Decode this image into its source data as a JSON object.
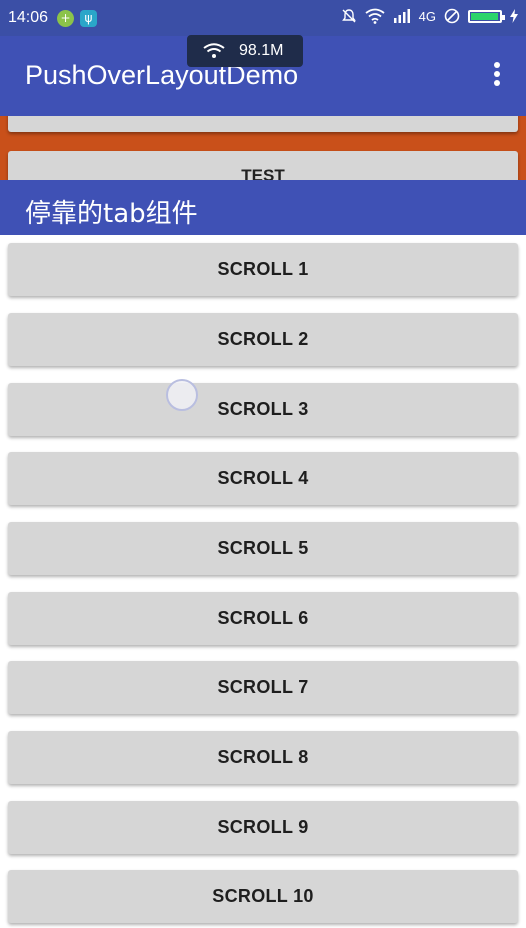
{
  "status_bar": {
    "time": "14:06",
    "network": "4G",
    "badges": [
      "plus-badge-icon",
      "usb-icon"
    ]
  },
  "network_overlay": {
    "speed": "98.1M"
  },
  "app_bar": {
    "title": "PushOverLayoutDemo"
  },
  "header_section": {
    "button_label": "TEST",
    "background": "#c9501a"
  },
  "tab_bar": {
    "label": "停靠的tab组件"
  },
  "list": {
    "items": [
      {
        "label": "SCROLL 1"
      },
      {
        "label": "SCROLL 2"
      },
      {
        "label": "SCROLL 3"
      },
      {
        "label": "SCROLL 4"
      },
      {
        "label": "SCROLL 5"
      },
      {
        "label": "SCROLL 6"
      },
      {
        "label": "SCROLL 7"
      },
      {
        "label": "SCROLL 8"
      },
      {
        "label": "SCROLL 9"
      },
      {
        "label": "SCROLL 10"
      }
    ]
  },
  "colors": {
    "primary": "#3f51b5",
    "status_bar": "#3b4fa6",
    "button": "#d6d6d6"
  }
}
